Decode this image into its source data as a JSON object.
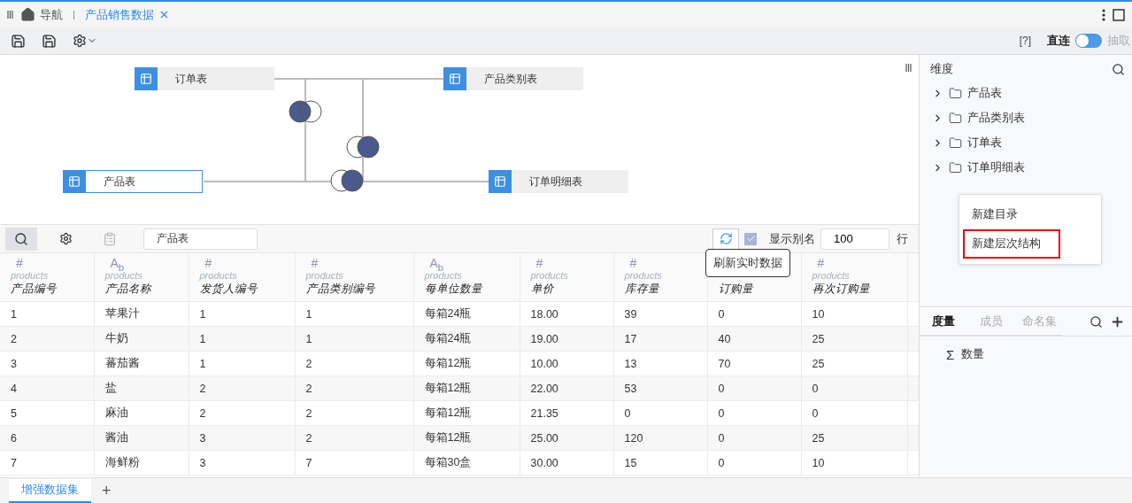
{
  "tabs": [
    {
      "label": "导航",
      "kind": "home",
      "selected": false
    },
    {
      "label": "产品销售数据",
      "kind": "doc",
      "selected": true
    }
  ],
  "toolbar": {
    "help": "[?]",
    "direct_label": "直连",
    "extract_label": "抽取",
    "extract": false
  },
  "diagram": {
    "nodes": [
      {
        "label": "订单表",
        "selected": false
      },
      {
        "label": "产品类别表",
        "selected": false
      },
      {
        "label": "产品表",
        "selected": true
      },
      {
        "label": "订单明细表",
        "selected": false
      }
    ],
    "joins": [
      {
        "kind": "left"
      },
      {
        "kind": "right"
      },
      {
        "kind": "right"
      }
    ]
  },
  "grid_toolbar": {
    "table_name": "产品表",
    "tooltip": "刷新实时数据",
    "alias_label": "显示别名",
    "show_alias": true,
    "row_limit": "100",
    "row_unit": "行"
  },
  "table": {
    "columns": [
      {
        "mark": "#",
        "source": "products",
        "name": "产品编号"
      },
      {
        "mark": "A$_{b}$",
        "source": "products",
        "name": "产品名称"
      },
      {
        "mark": "#",
        "source": "products",
        "name": "发货人编号"
      },
      {
        "mark": "#",
        "source": "products",
        "name": "产品类别编号"
      },
      {
        "mark": "A$_{b}$",
        "source": "products",
        "name": "每单位数量"
      },
      {
        "mark": "#",
        "source": "products",
        "name": "单价"
      },
      {
        "mark": "#",
        "source": "products",
        "name": "库存量"
      },
      {
        "name": "订购量"
      },
      {
        "mark": "#",
        "source": "products",
        "name": "再次订购量"
      }
    ],
    "rows": [
      [
        "1",
        "苹果汁",
        "1",
        "1",
        "每箱24瓶",
        "18.00",
        "39",
        "0",
        "10"
      ],
      [
        "2",
        "牛奶",
        "1",
        "1",
        "每箱24瓶",
        "19.00",
        "17",
        "40",
        "25"
      ],
      [
        "3",
        "蕃茄酱",
        "1",
        "2",
        "每箱12瓶",
        "10.00",
        "13",
        "70",
        "25"
      ],
      [
        "4",
        "盐",
        "2",
        "2",
        "每箱12瓶",
        "22.00",
        "53",
        "0",
        "0"
      ],
      [
        "5",
        "麻油",
        "2",
        "2",
        "每箱12瓶",
        "21.35",
        "0",
        "0",
        "0"
      ],
      [
        "6",
        "酱油",
        "3",
        "2",
        "每箱12瓶",
        "25.00",
        "120",
        "0",
        "25"
      ],
      [
        "7",
        "海鲜粉",
        "3",
        "7",
        "每箱30盒",
        "30.00",
        "15",
        "0",
        "10"
      ]
    ]
  },
  "dimensions": {
    "title": "维度",
    "items": [
      {
        "label": "产品表",
        "expanded": false
      },
      {
        "label": "产品类别表",
        "expanded": false
      },
      {
        "label": "订单表",
        "expanded": false
      },
      {
        "label": "订单明细表",
        "expanded": false
      }
    ]
  },
  "context_menu": [
    {
      "label": "新建目录",
      "selected": false
    },
    {
      "label": "新建层次结构",
      "selected": true
    }
  ],
  "measures": {
    "tabs": [
      {
        "label": "度量",
        "selected": true
      },
      {
        "label": "成员",
        "selected": false
      },
      {
        "label": "命名集",
        "selected": false
      }
    ],
    "items": [
      {
        "symbol": "Σ",
        "label": "数量"
      }
    ]
  },
  "bottom_tabs": [
    {
      "label": "增强数据集",
      "selected": true
    }
  ],
  "add_tab": "+"
}
